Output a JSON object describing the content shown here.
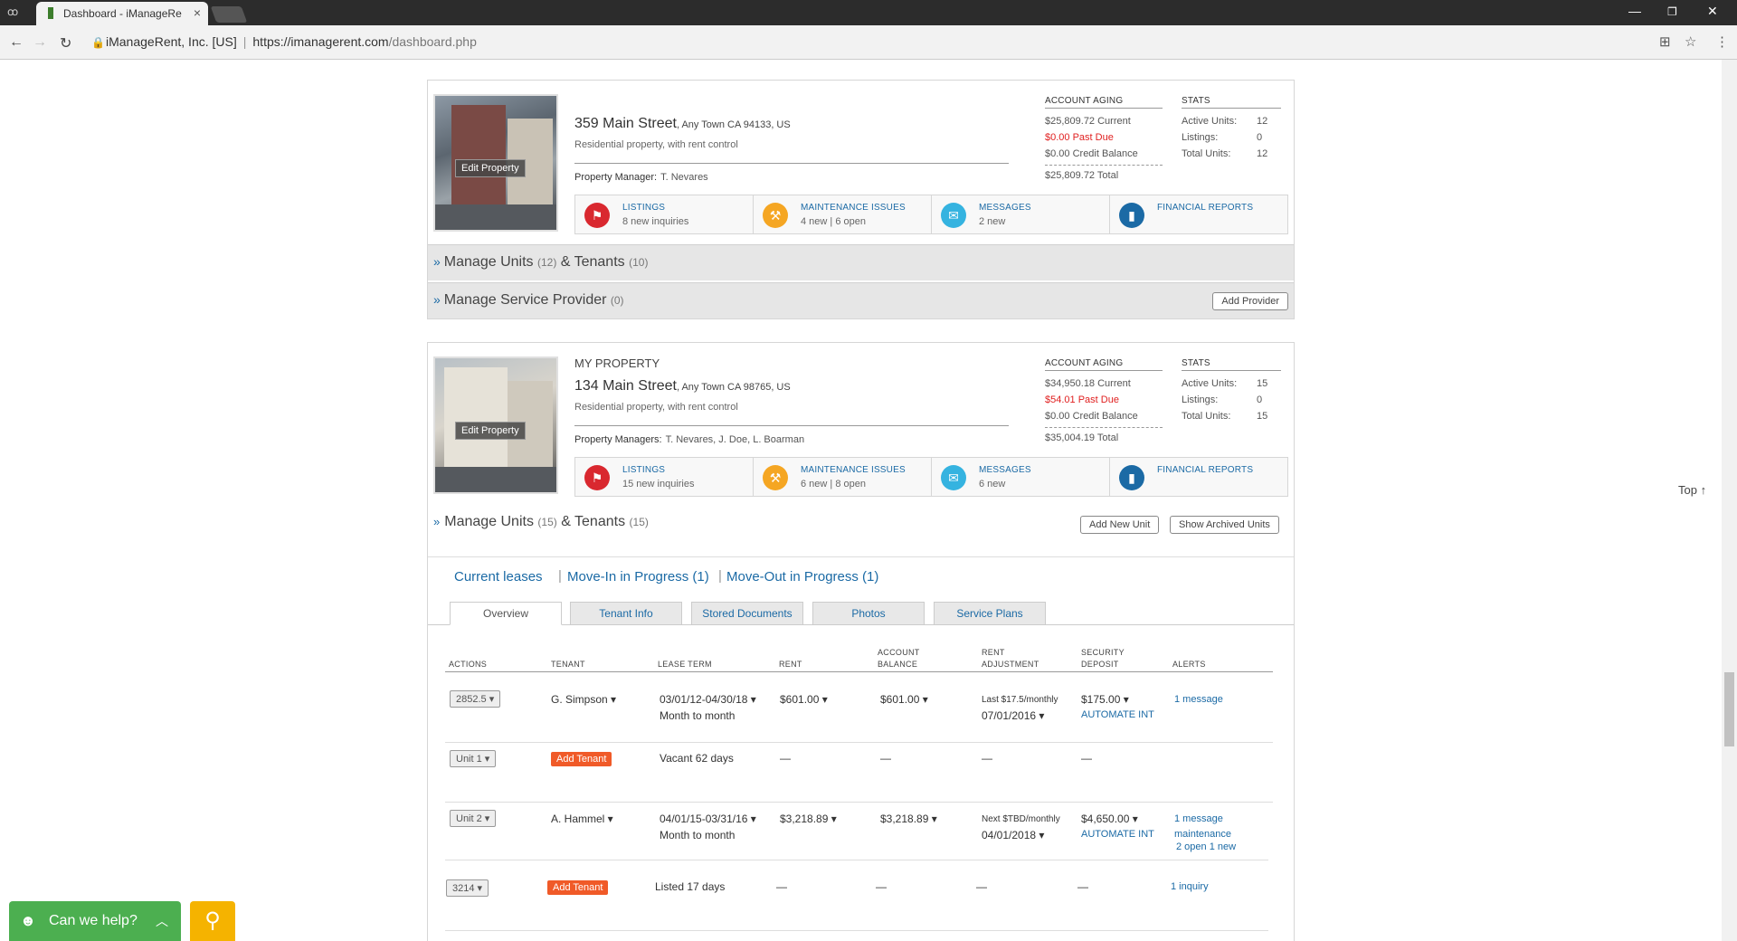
{
  "browser": {
    "tab_title": "Dashboard - iManageRe",
    "site_identity": "iManageRent, Inc. [US]",
    "url_host": "https://imanagerent.com",
    "url_path": "/dashboard.php"
  },
  "properties": [
    {
      "name_line": "",
      "street": "359 Main Street",
      "city": ", Any Town CA 94133, US",
      "description": "Residential property, with rent control",
      "manager_label": "Property Manager:",
      "managers": "T. Nevares",
      "edit": "Edit Property",
      "aging_title": "ACCOUNT AGING",
      "current": "$25,809.72 Current",
      "past_due": "$0.00 Past Due",
      "credit": "$0.00 Credit Balance",
      "total": "$25,809.72 Total",
      "stats_title": "STATS",
      "active_label": "Active Units:",
      "active": "12",
      "listings_label": "Listings:",
      "listings": "0",
      "total_label": "Total Units:",
      "total_units": "12",
      "quick": [
        {
          "label": "LISTINGS",
          "sub": "8 new inquiries"
        },
        {
          "label": "MAINTENANCE ISSUES",
          "sub": "4 new | 6 open"
        },
        {
          "label": "MESSAGES",
          "sub": "2 new"
        },
        {
          "label": "FINANCIAL REPORTS",
          "sub": ""
        }
      ],
      "units_bar": {
        "prefix": "Manage Units",
        "units": "(12)",
        "mid": "& Tenants",
        "tenants": "(10)"
      },
      "provider_bar": {
        "prefix": "Manage Service Provider",
        "count": "(0)",
        "button": "Add Provider"
      }
    },
    {
      "name_line": "MY PROPERTY",
      "street": "134 Main Street",
      "city": ", Any Town CA 98765, US",
      "description": "Residential property, with rent control",
      "manager_label": "Property Managers:",
      "managers": "T. Nevares, J. Doe, L. Boarman",
      "edit": "Edit Property",
      "aging_title": "ACCOUNT AGING",
      "current": "$34,950.18 Current",
      "past_due": "$54.01 Past Due",
      "credit": "$0.00 Credit Balance",
      "total": "$35,004.19 Total",
      "stats_title": "STATS",
      "active_label": "Active Units:",
      "active": "15",
      "listings_label": "Listings:",
      "listings": "0",
      "total_label": "Total Units:",
      "total_units": "15",
      "quick": [
        {
          "label": "LISTINGS",
          "sub": "15 new inquiries"
        },
        {
          "label": "MAINTENANCE ISSUES",
          "sub": "6 new | 8 open"
        },
        {
          "label": "MESSAGES",
          "sub": "6 new"
        },
        {
          "label": "FINANCIAL REPORTS",
          "sub": ""
        }
      ],
      "units_bar": {
        "prefix": "Manage Units",
        "units": "(15)",
        "mid": "& Tenants",
        "tenants": "(15)",
        "add_unit": "Add New Unit",
        "archived": "Show Archived Units"
      }
    }
  ],
  "lease_links": [
    "Current leases",
    "Move-In in Progress (1)",
    "Move-Out in Progress (1)"
  ],
  "tabs": [
    "Overview",
    "Tenant Info",
    "Stored Documents",
    "Photos",
    "Service Plans"
  ],
  "table": {
    "headers": [
      "ACTIONS",
      "TENANT",
      "LEASE TERM",
      "RENT",
      "ACCOUNT",
      "BALANCE",
      "RENT",
      "ADJUSTMENT",
      "SECURITY",
      "DEPOSIT",
      "ALERTS"
    ],
    "rows": [
      {
        "unit": "2852.5",
        "tenant": "G. Simpson",
        "term": "03/01/12-04/30/18",
        "term2": "Month to month",
        "rent": "$601.00",
        "balance": "$601.00",
        "adj": "Last $17.5/monthly",
        "adj2": "07/01/2016",
        "deposit": "$175.00",
        "deposit2": "AUTOMATE INT",
        "alert1": "1 message",
        "alert2": "",
        "alert3": ""
      },
      {
        "unit": "Unit 1",
        "tenant_btn": "Add Tenant",
        "term": "Vacant 62 days",
        "rent": "—",
        "balance": "—",
        "adj": "—",
        "deposit": "—"
      },
      {
        "unit": "Unit 2",
        "tenant": "A. Hammel",
        "term": "04/01/15-03/31/16",
        "term2": "Month to month",
        "rent": "$3,218.89",
        "balance": "$3,218.89",
        "adj": "Next $TBD/monthly",
        "adj2": "04/01/2018",
        "deposit": "$4,650.00",
        "deposit2": "AUTOMATE INT",
        "alert1": "1 message",
        "alert2": "maintenance",
        "alert3": "2 open 1 new"
      },
      {
        "unit": "3214",
        "tenant_btn": "Add Tenant",
        "term": "Listed 17 days",
        "rent": "—",
        "balance": "—",
        "adj": "—",
        "deposit": "—",
        "alert1": "1 inquiry"
      }
    ]
  },
  "help": {
    "label": "Can we help?"
  },
  "top_link": "Top ↑"
}
